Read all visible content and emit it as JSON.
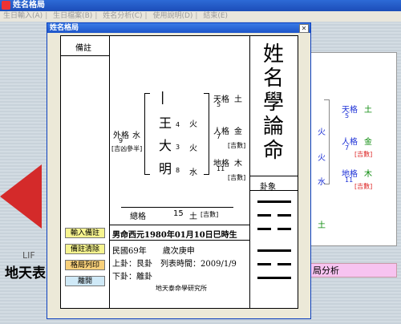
{
  "app": {
    "title": "姓名格局"
  },
  "menu": [
    "生日輸入(A)",
    "生日檔案(B)",
    "姓名分析(C)",
    "使用說明(D)",
    "結束(E)"
  ],
  "background": {
    "right_panel": {
      "lines": [
        {
          "wx": "火",
          "ge": "天格",
          "num": "5",
          "el": "土"
        },
        {
          "wx": "火",
          "ge": "人格",
          "num": "7",
          "el": "金",
          "tag": "[吉數]"
        },
        {
          "wx": "水",
          "ge": "地格",
          "num": "11",
          "el": "木",
          "tag": "[吉數]"
        }
      ],
      "extra_el": "土",
      "button": "局分析"
    },
    "left_text_small": "LIF",
    "left_text_big": "地天表"
  },
  "dialog": {
    "title": "姓名格局",
    "sidebar_header": "備註",
    "buttons": [
      "輸入備註",
      "備註清除",
      "格局列印",
      "離開"
    ],
    "heading": "姓名學論命",
    "gua_label": "卦象",
    "chars": [
      {
        "ch": "|",
        "stroke": "1"
      },
      {
        "ch": "王",
        "stroke": "4"
      },
      {
        "ch": "大",
        "stroke": "3"
      },
      {
        "ch": "明",
        "stroke": "8"
      }
    ],
    "elements": [
      "火",
      "火",
      "水"
    ],
    "wai_ge": {
      "label": "外格",
      "element": "水",
      "num": "9",
      "tag": "[吉凶參半]"
    },
    "right_ge": [
      {
        "label": "天格",
        "num": "5",
        "element": "土",
        "tag": ""
      },
      {
        "label": "人格",
        "num": "7",
        "element": "金",
        "tag": "[吉數]"
      },
      {
        "label": "地格",
        "num": "11",
        "element": "木",
        "tag": "[吉數]"
      }
    ],
    "zong_ge": {
      "label": "總格",
      "num": "15",
      "element": "土",
      "tag": "[吉數]"
    },
    "birth": "男命西元1980年01月10日巳時生",
    "line1": "民國69年　　歲次庚申",
    "line2": "上卦：艮卦　列表時間：2009/1/9",
    "line3": "下卦：離卦",
    "footer": "地天泰命學研究所",
    "button_colors": [
      "#f6f48f",
      "#f6f48f",
      "#f8d07a",
      "#cfe9f7"
    ]
  }
}
